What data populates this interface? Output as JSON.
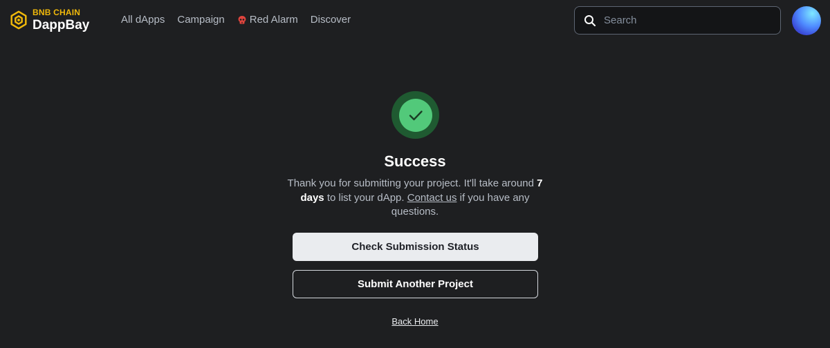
{
  "header": {
    "logo": {
      "brand": "BNB CHAIN",
      "product": "DappBay"
    },
    "nav": [
      {
        "label": "All dApps"
      },
      {
        "label": "Campaign"
      },
      {
        "label": "Red Alarm",
        "icon": "skull-icon"
      },
      {
        "label": "Discover"
      }
    ],
    "search": {
      "placeholder": "Search",
      "value": ""
    }
  },
  "success": {
    "title": "Success",
    "message_part1": "Thank you for submitting your project. It'll take around",
    "message_bold": "7 days",
    "message_part2": "to list your dApp.",
    "contact_link": "Contact us",
    "message_part3": "if you have any questions."
  },
  "actions": {
    "check_status": "Check Submission Status",
    "submit_another": "Submit Another Project",
    "back_home": "Back Home"
  },
  "colors": {
    "background": "#1e1f21",
    "brand_yellow": "#f0b90b",
    "success_green": "#52c97a",
    "success_ring": "#1f5a31",
    "primary_button": "#eaecef"
  }
}
